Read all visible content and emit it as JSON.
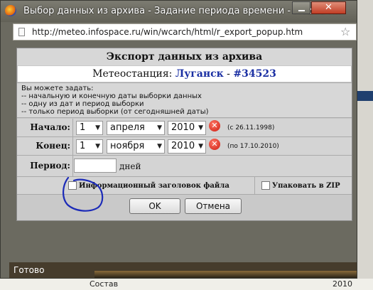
{
  "window": {
    "title": "Выбор данных из архива - Задание периода времени - Mozilla F...",
    "close_glyph": "✕",
    "url": "http://meteo.infospace.ru/win/wcarch/html/r_export_popup.htm"
  },
  "dialog": {
    "heading": "Экспорт данных из архива",
    "station_prefix": "Метеостанция: ",
    "station_city": "Луганск",
    "station_sep": " - ",
    "station_code": "#34523",
    "info_lines": [
      "Вы можете задать:",
      "-- начальную и конечную даты выборки данных",
      "-- одну из дат и период выборки",
      "-- только период выборки (от сегодняшней даты)"
    ],
    "start": {
      "label": "Начало:",
      "day": "1",
      "month": "апреля",
      "year": "2010",
      "hint": "(с 26.11.1998)"
    },
    "end": {
      "label": "Конец:",
      "day": "1",
      "month": "ноября",
      "year": "2010",
      "hint": "(по 17.10.2010)"
    },
    "period": {
      "label": "Период:",
      "value": "",
      "unit": "дней"
    },
    "header_checkbox_label": "Информационный заголовок файла",
    "zip_checkbox_label": "Упаковать в ZIP",
    "ok_label": "OK",
    "cancel_label": "Отмена"
  },
  "status": {
    "text": "Готово"
  },
  "background": {
    "bottom_text": "Состав",
    "bottom_text2": "2010"
  },
  "colors": {
    "station_link": "#1a2fa3",
    "annotation_ink": "#1c2bb8",
    "error_icon": "#cc1b10"
  }
}
